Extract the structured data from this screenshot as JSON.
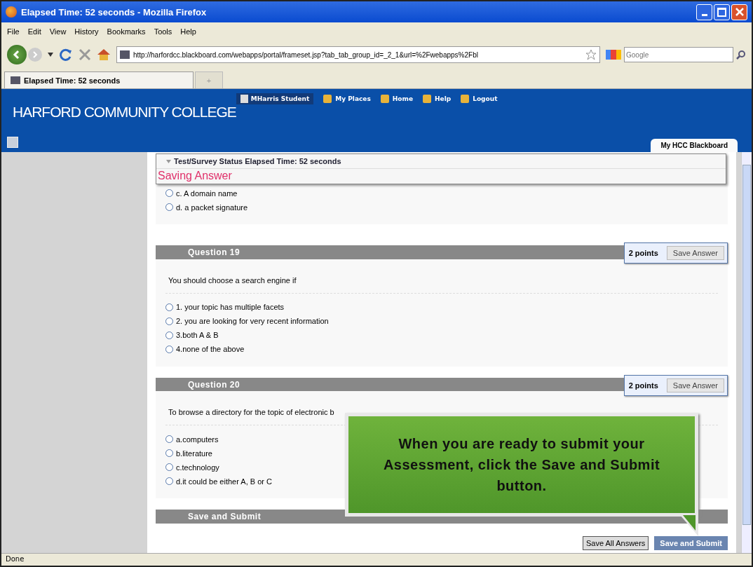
{
  "window": {
    "title": "Elapsed Time: 52 seconds - Mozilla Firefox"
  },
  "menu": [
    "File",
    "Edit",
    "View",
    "History",
    "Bookmarks",
    "Tools",
    "Help"
  ],
  "address_bar": {
    "value": "http://harfordcc.blackboard.com/webapps/portal/frameset.jsp?tab_tab_group_id=_2_1&url=%2Fwebapps%2Fbl"
  },
  "search": {
    "placeholder": "Google"
  },
  "tabs": [
    {
      "label": "Elapsed Time: 52 seconds",
      "selected": true
    },
    {
      "label": "+",
      "selected": false
    }
  ],
  "header": {
    "logo": "HARFORD COMMUNITY COLLEGE",
    "user": "MHarris Student",
    "links": [
      "My Places",
      "Home",
      "Help",
      "Logout"
    ],
    "tab": "My HCC Blackboard"
  },
  "status_panel": {
    "title": "Test/Survey Status Elapsed Time: 52 seconds",
    "message": "Saving Answer"
  },
  "prev_options": [
    {
      "label": "c. A domain name",
      "selected": false
    },
    {
      "label": "d. a packet signature",
      "selected": false
    }
  ],
  "questions": [
    {
      "title": "Question 19",
      "points": "2 points",
      "button": "Save Answer",
      "text": "You should choose a search engine if",
      "options": [
        {
          "label": "1. your topic has multiple facets",
          "selected": false
        },
        {
          "label": "2. you are looking for very recent information",
          "selected": false
        },
        {
          "label": "3.both A & B",
          "selected": false
        },
        {
          "label": "4.none of the above",
          "selected": false
        }
      ]
    },
    {
      "title": "Question 20",
      "points": "2 points",
      "button": "Save Answer",
      "text": "To browse a directory for the topic of electronic b",
      "options": [
        {
          "label": "a.computers",
          "selected": false
        },
        {
          "label": "b.literature",
          "selected": false
        },
        {
          "label": "c.technology",
          "selected": false
        },
        {
          "label": "d.it could be either A, B or C",
          "selected": false
        }
      ]
    }
  ],
  "submit_section": {
    "title": "Save and Submit",
    "buttons": [
      "Save All Answers",
      "Save and Submit"
    ]
  },
  "callout": "When you are ready to submit your Assessment, click the Save and Submit button.",
  "status_bar": "Done"
}
